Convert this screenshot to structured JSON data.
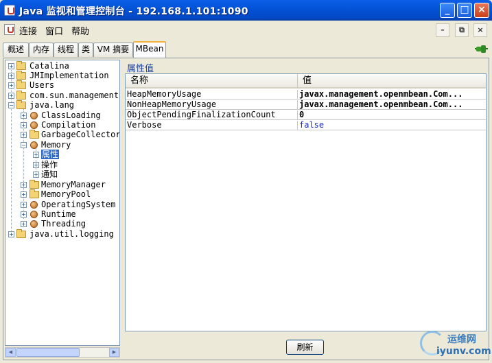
{
  "window": {
    "title": "Java 监视和管理控制台 - 192.168.1.101:1090",
    "minimize": "_",
    "maximize": "□",
    "close": "×"
  },
  "menubar": {
    "items": [
      "连接",
      "窗口",
      "帮助"
    ],
    "mdi_minimize": "–",
    "mdi_restore": "⧉",
    "mdi_close": "×"
  },
  "tabs": [
    {
      "label": "概述",
      "active": false
    },
    {
      "label": "内存",
      "active": false
    },
    {
      "label": "线程",
      "active": false
    },
    {
      "label": "类",
      "active": false
    },
    {
      "label": "VM 摘要",
      "active": false
    },
    {
      "label": "MBean",
      "active": true
    }
  ],
  "tree": {
    "nodes": [
      {
        "label": "Catalina",
        "icon": "folder-icon",
        "expanded": false
      },
      {
        "label": "JMImplementation",
        "icon": "folder-icon",
        "expanded": false
      },
      {
        "label": "Users",
        "icon": "folder-icon",
        "expanded": false
      },
      {
        "label": "com.sun.management",
        "icon": "folder-icon",
        "expanded": false
      },
      {
        "label": "java.lang",
        "icon": "folder-icon",
        "expanded": true
      },
      {
        "label": "ClassLoading",
        "icon": "bean-icon",
        "expanded": false
      },
      {
        "label": "Compilation",
        "icon": "bean-icon",
        "expanded": false
      },
      {
        "label": "GarbageCollector",
        "icon": "folder-icon",
        "expanded": false
      },
      {
        "label": "Memory",
        "icon": "bean-icon",
        "expanded": true
      },
      {
        "label": "属性",
        "icon": "",
        "expanded": false,
        "selected": true
      },
      {
        "label": "操作",
        "icon": "",
        "expanded": false
      },
      {
        "label": "通知",
        "icon": "",
        "expanded": false
      },
      {
        "label": "MemoryManager",
        "icon": "folder-icon",
        "expanded": false
      },
      {
        "label": "MemoryPool",
        "icon": "folder-icon",
        "expanded": false
      },
      {
        "label": "OperatingSystem",
        "icon": "bean-icon",
        "expanded": false
      },
      {
        "label": "Runtime",
        "icon": "bean-icon",
        "expanded": false
      },
      {
        "label": "Threading",
        "icon": "bean-icon",
        "expanded": false
      },
      {
        "label": "java.util.logging",
        "icon": "folder-icon",
        "expanded": false
      }
    ]
  },
  "attributes": {
    "section_title": "属性值",
    "columns": [
      "名称",
      "值"
    ],
    "rows": [
      {
        "name": "HeapMemoryUsage",
        "value": "javax.management.openmbean.Com...",
        "style": "bold"
      },
      {
        "name": "NonHeapMemoryUsage",
        "value": "javax.management.openmbean.Com...",
        "style": "bold"
      },
      {
        "name": "ObjectPendingFinalizationCount",
        "value": "0",
        "style": "bold"
      },
      {
        "name": "Verbose",
        "value": "false",
        "style": "blue"
      }
    ]
  },
  "buttons": {
    "refresh": "刷新"
  },
  "watermark": {
    "top": "运维网",
    "bottom": "iyunv.com"
  }
}
